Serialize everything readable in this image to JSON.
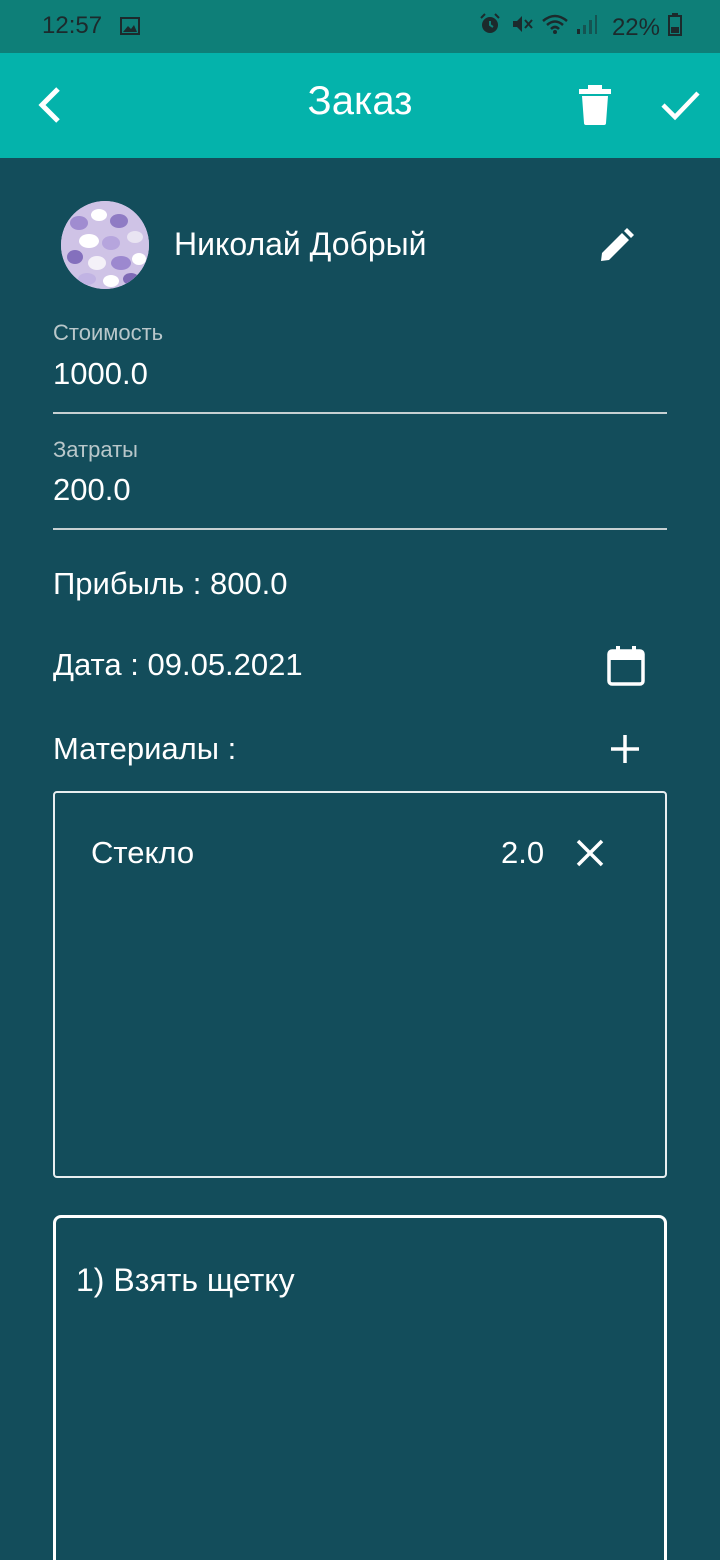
{
  "status_bar": {
    "time": "12:57",
    "battery": "22%",
    "icons": [
      "image-icon",
      "alarm-icon",
      "mute-icon",
      "wifi-icon",
      "signal-icon",
      "battery-icon"
    ]
  },
  "app_bar": {
    "title": "Заказ",
    "icons": [
      "back-arrow-icon",
      "trash-icon",
      "check-icon"
    ],
    "color": "#04b3ab"
  },
  "client": {
    "name": "Николай Добрый"
  },
  "cost": {
    "label": "Стоимость",
    "value": "1000.0"
  },
  "expenses": {
    "label": "Затраты",
    "value": "200.0"
  },
  "profit_text": "Прибыль : 800.0",
  "date_text": "Дата : 09.05.2021",
  "materials": {
    "label": "Материалы :",
    "items": [
      {
        "name": "Стекло",
        "qty": "2.0"
      }
    ]
  },
  "notes": {
    "text": "1) Взять щетку"
  },
  "colors": {
    "background": "#134d5b",
    "status_bar": "#0e7f78"
  }
}
